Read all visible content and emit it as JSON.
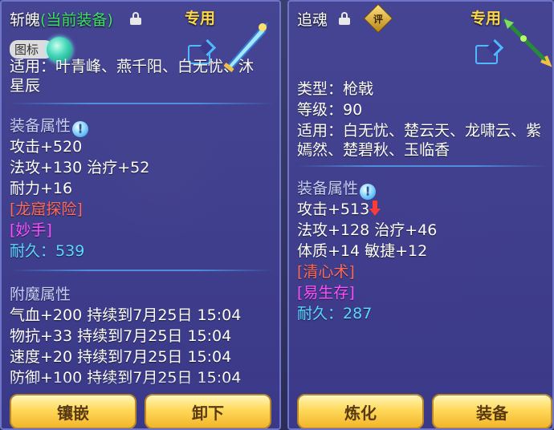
{
  "left_panel": {
    "title": "斩魄",
    "title_suffix": "(当前装备)",
    "tag": "专用",
    "badge": "图标",
    "usage_partial": "适用：叶青峰、燕千阳、白无忧、沐",
    "usage_cont": "星辰",
    "section_attr": "装备属性",
    "stats": [
      "攻击+520",
      "法攻+130 治疗+52",
      "耐力+16"
    ],
    "skill_1": "[龙窟探险]",
    "skill_2": "[妙手]",
    "durability_label": "耐久：",
    "durability_value": "539",
    "section_enchant": "附魔属性",
    "enchants": [
      "气血+200 持续到7月25日 15:04",
      "物抗+33 持续到7月25日 15:04",
      "速度+20 持续到7月25日 15:04",
      "防御+100 持续到7月25日 15:04"
    ],
    "btn_left": "镶嵌",
    "btn_right": "卸下"
  },
  "right_panel": {
    "title": "追魂",
    "eval_icon_text": "评",
    "tag": "专用",
    "type": "类型：枪戟",
    "level": "等级：90",
    "usage": "适用：白无忧、楚云天、龙啸云、紫",
    "usage_cont": "嫣然、楚碧秋、玉临香",
    "section_attr": "装备属性",
    "stat_attack": "攻击+513",
    "stats": [
      "法攻+128 治疗+46",
      "体质+14 敏捷+12"
    ],
    "skill_1": "[清心术]",
    "skill_2": "[易生存]",
    "durability_label": "耐久：",
    "durability_value": "287",
    "btn_left": "炼化",
    "btn_right": "装备"
  },
  "colors": {
    "current_equipped": "#3fe06a",
    "tag": "#ffd84a",
    "skill_red": "#ff6a5a",
    "skill_magenta": "#ff4fff",
    "durability": "#5ad8ff",
    "section": "#c6d0ff"
  }
}
